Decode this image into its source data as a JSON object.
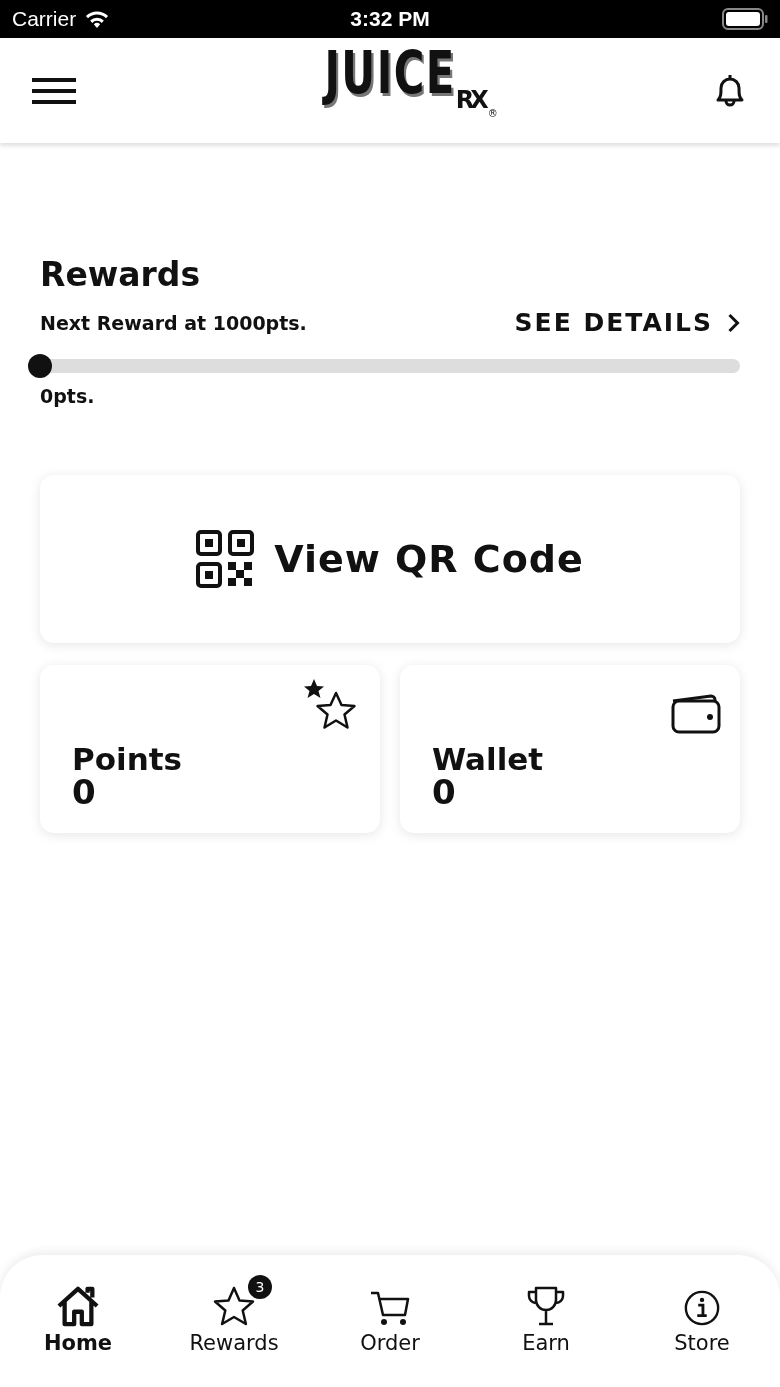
{
  "status_bar": {
    "carrier": "Carrier",
    "time": "3:32 PM"
  },
  "header": {
    "logo": "JUICE",
    "logo_mark": "RX",
    "registered": "®"
  },
  "rewards": {
    "title": "Rewards",
    "next_reward": "Next Reward at 1000pts.",
    "details_link": "SEE DETAILS",
    "level": 0,
    "points_label": "0pts."
  },
  "qr_button": {
    "label": "View QR Code"
  },
  "cards": [
    {
      "kind": "points",
      "label": "Points",
      "value": "0"
    },
    {
      "kind": "wallet",
      "label": "Wallet",
      "value": "0"
    }
  ],
  "tabs": [
    {
      "kind": "home",
      "label": "Home",
      "selected": true
    },
    {
      "kind": "rewards",
      "label": "Rewards",
      "selected": false,
      "badge": "3"
    },
    {
      "kind": "order",
      "label": "Order",
      "selected": false
    },
    {
      "kind": "earn",
      "label": "Earn",
      "selected": false
    },
    {
      "kind": "store",
      "label": "Store",
      "selected": false
    }
  ]
}
